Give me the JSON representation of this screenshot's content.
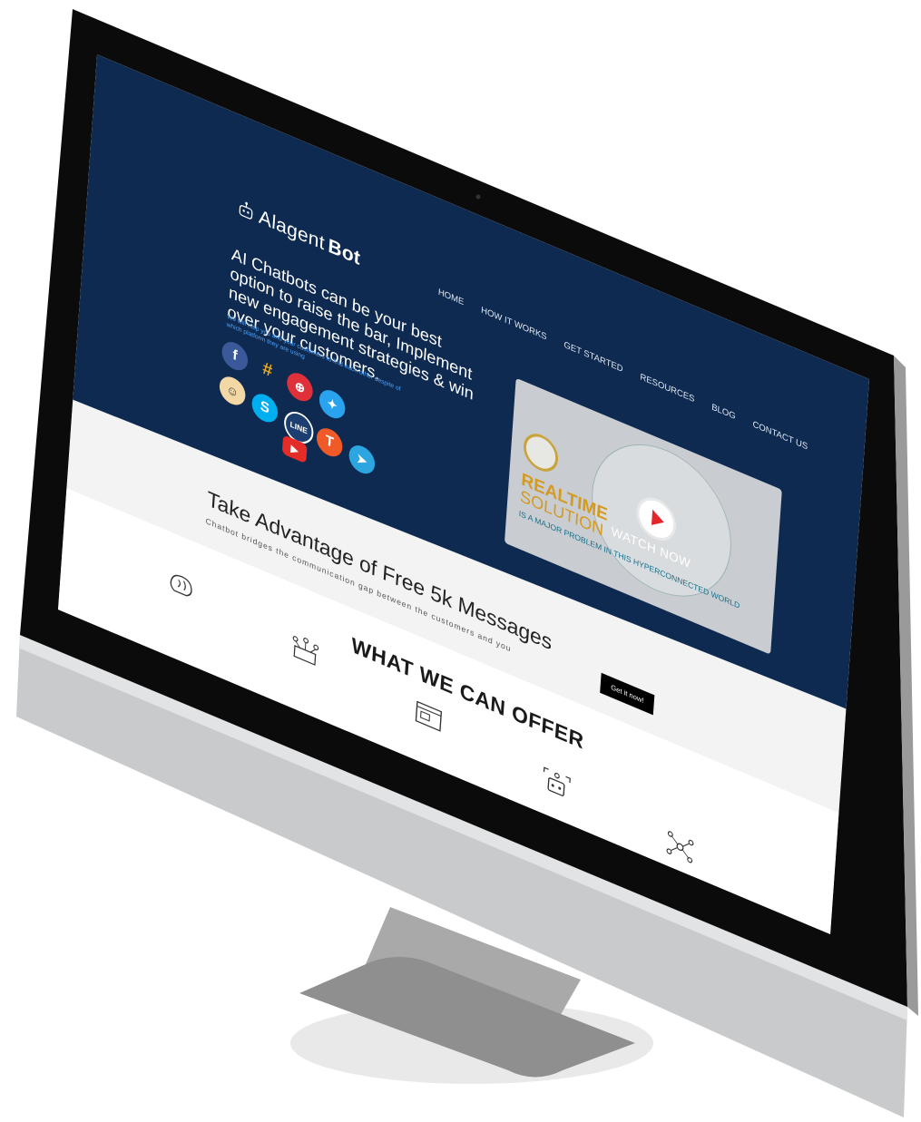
{
  "site": {
    "logo": {
      "prefix": "Alagent",
      "strong": "Bot"
    },
    "nav": [
      "HOME",
      "HOW IT WORKS",
      "GET STARTED",
      "RESOURCES",
      "BLOG",
      "CONTACT US"
    ],
    "hero": {
      "headline": "AI Chatbots can be your best option to raise the bar, Implement new engagement strategies & win over your customers.",
      "subtext": "We will help you and your customers to find each other despite of which platform they are using"
    },
    "platforms": [
      "facebook-icon",
      "slack-icon",
      "twilio-icon",
      "twitter-icon",
      "mailchimp-icon",
      "skype-icon",
      "line-icon",
      "telegram-app-icon",
      "telegram-icon",
      "youtube-icon"
    ],
    "video": {
      "overlay_label": "WATCH NOW",
      "title_line1": "REALTIME",
      "title_line2": "SOLUTION",
      "caption": "IS A MAJOR PROBLEM IN THIS HYPERCONNECTED WORLD"
    },
    "promo": {
      "title": "Take Advantage of Free 5k Messages",
      "subtitle": "Chatbot bridges the communication gap between the customers and you",
      "cta": "Get it now!"
    },
    "offer": {
      "title": "WHAT WE CAN OFFER",
      "features": [
        "brain-icon",
        "network-icon",
        "chat-window-icon",
        "bot-scan-icon",
        "connections-icon"
      ]
    }
  },
  "colors": {
    "hero_bg": "#0e2a50",
    "accent_blue": "#4ea3ff",
    "gold": "#d49a21",
    "cta_bg": "#000000"
  }
}
